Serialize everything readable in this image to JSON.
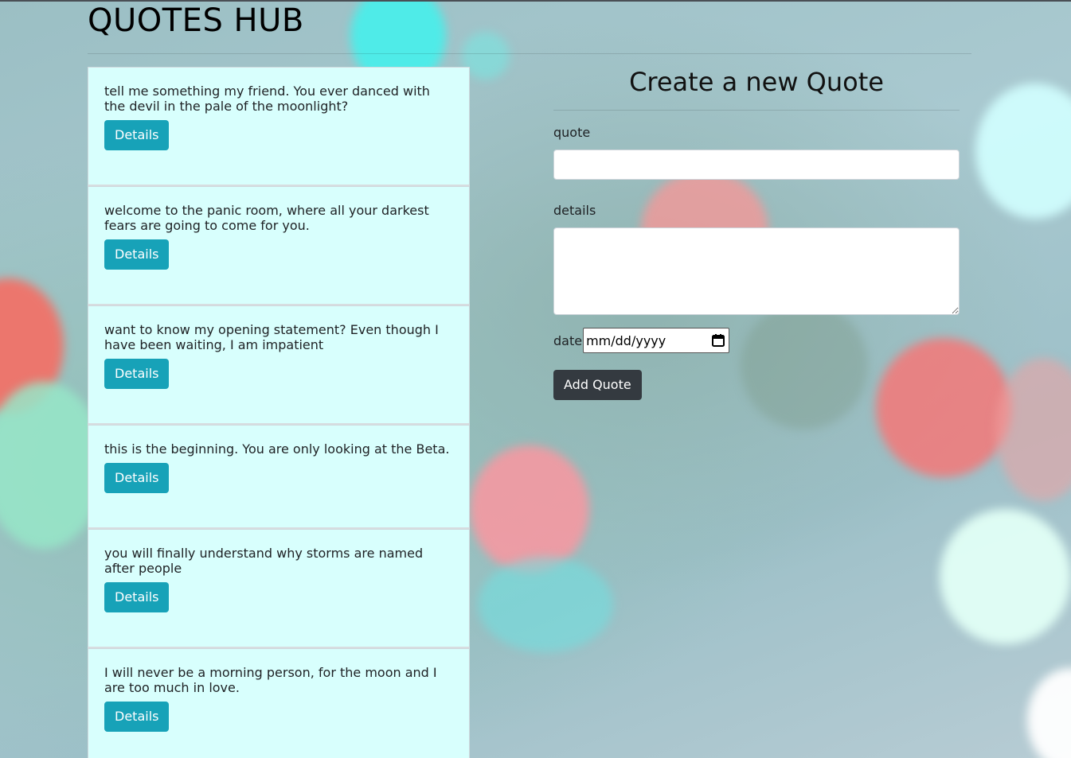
{
  "header": {
    "title": "QUOTES HUB"
  },
  "quotes": [
    {
      "text": "tell me something my friend. You ever danced with the devil in the pale of the moonlight?",
      "button_label": "Details"
    },
    {
      "text": "welcome to the panic room, where all your darkest fears are going to come for you.",
      "button_label": "Details"
    },
    {
      "text": "want to know my opening statement? Even though I have been waiting, I am impatient",
      "button_label": "Details"
    },
    {
      "text": "this is the beginning. You are only looking at the Beta.",
      "button_label": "Details"
    },
    {
      "text": "you will finally understand why storms are named after people",
      "button_label": "Details"
    },
    {
      "text": "I will never be a morning person, for the moon and I are too much in love.",
      "button_label": "Details"
    }
  ],
  "form": {
    "heading": "Create a new Quote",
    "quote_label": "quote",
    "quote_value": "",
    "details_label": "details",
    "details_value": "",
    "date_label": "date",
    "date_placeholder": "mm/dd/yyyy",
    "submit_label": "Add Quote"
  },
  "colors": {
    "card_background": "#d8fffd",
    "details_button": "#17a2b8",
    "submit_button": "#343a40"
  },
  "icons": {
    "date_picker": "calendar-icon"
  }
}
